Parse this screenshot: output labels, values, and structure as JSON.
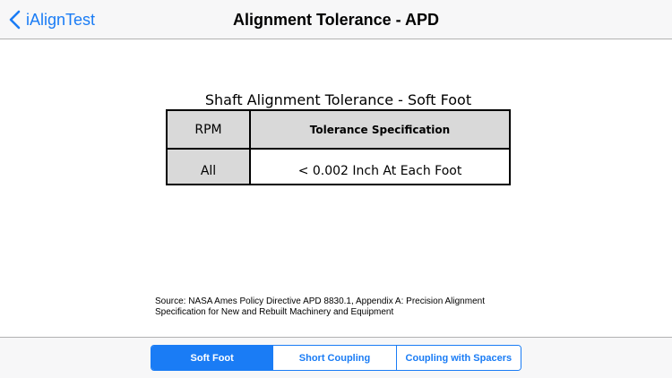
{
  "navbar": {
    "back_label": "iAlignTest",
    "title": "Alignment Tolerance - APD"
  },
  "table": {
    "title": "Shaft Alignment Tolerance - Soft Foot",
    "headers": [
      "RPM",
      "Tolerance Specification"
    ],
    "rows": [
      [
        "All",
        "< 0.002 Inch At Each Foot"
      ]
    ]
  },
  "source": {
    "line1": "Source: NASA Ames Policy Directive APD 8830.1, Appendix A: Precision Alignment",
    "line2": "Specification for New and Rebuilt Machinery and Equipment"
  },
  "segmented": {
    "selected_index": 0,
    "items": [
      {
        "label": "Soft Foot"
      },
      {
        "label": "Short Coupling"
      },
      {
        "label": "Coupling with Spacers"
      }
    ]
  },
  "colors": {
    "accent": "#1a7cf5",
    "header_fill": "#d9d9d9"
  },
  "icons": {
    "back": "chevron-left-icon"
  }
}
